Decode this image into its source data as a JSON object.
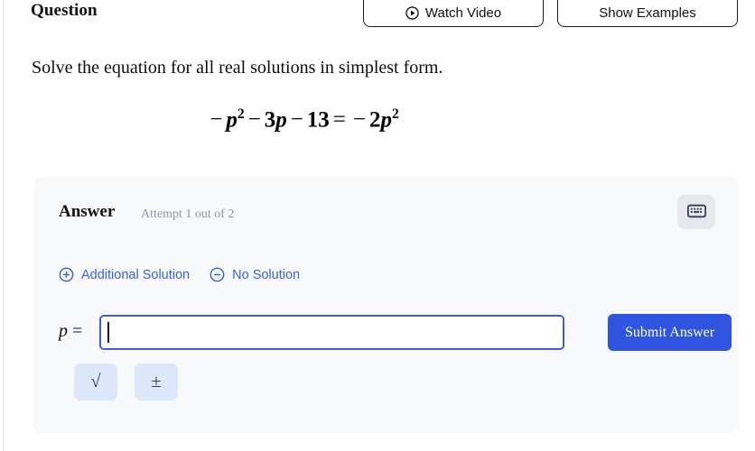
{
  "header": {
    "title": "Question",
    "watch_video_label": "Watch Video",
    "watch_video_icon": "play-circle-icon",
    "show_examples_label": "Show Examples"
  },
  "prompt": {
    "text": "Solve the equation for all real solutions in simplest form."
  },
  "equation": {
    "plain": "-p^2 - 3p - 13 = -2p^2",
    "lhs_term1_sign": "−",
    "lhs_term1_var": "p",
    "lhs_term1_exp": "2",
    "op1": "−",
    "lhs_term2_coef": "3",
    "lhs_term2_var": "p",
    "op2": "−",
    "lhs_term3": "13",
    "equals": "=",
    "rhs_sign": "−",
    "rhs_coef": "2",
    "rhs_var": "p",
    "rhs_exp": "2"
  },
  "answer": {
    "heading": "Answer",
    "attempt_text": "Attempt 1 out of 2",
    "keyboard_icon": "keyboard-icon",
    "additional_solution_label": "Additional Solution",
    "additional_solution_icon": "plus-circle-icon",
    "no_solution_label": "No Solution",
    "no_solution_icon": "minus-circle-icon",
    "variable_label": "p",
    "equals_sign": "=",
    "input_value": "",
    "input_placeholder": "",
    "submit_label": "Submit Answer",
    "tools": [
      {
        "name": "square-root",
        "glyph": "√"
      },
      {
        "name": "plus-minus",
        "glyph": "±"
      }
    ]
  },
  "colors": {
    "accent_blue": "#3b5ce8",
    "submit_blue": "#2f55e0",
    "panel_bg": "#f8f9fb",
    "tool_bg": "#dde7fa",
    "keyboard_bg": "#e6e8ed",
    "muted_text": "#8e95a4"
  }
}
